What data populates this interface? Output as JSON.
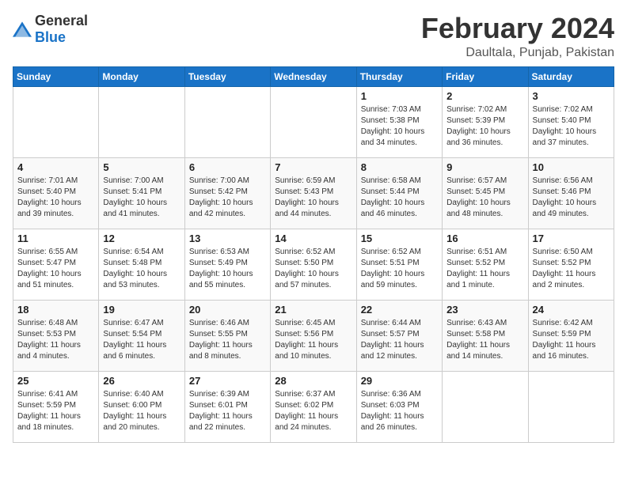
{
  "logo": {
    "general": "General",
    "blue": "Blue"
  },
  "title": "February 2024",
  "location": "Daultala, Punjab, Pakistan",
  "days_of_week": [
    "Sunday",
    "Monday",
    "Tuesday",
    "Wednesday",
    "Thursday",
    "Friday",
    "Saturday"
  ],
  "weeks": [
    [
      {
        "day": "",
        "info": ""
      },
      {
        "day": "",
        "info": ""
      },
      {
        "day": "",
        "info": ""
      },
      {
        "day": "",
        "info": ""
      },
      {
        "day": "1",
        "info": "Sunrise: 7:03 AM\nSunset: 5:38 PM\nDaylight: 10 hours\nand 34 minutes."
      },
      {
        "day": "2",
        "info": "Sunrise: 7:02 AM\nSunset: 5:39 PM\nDaylight: 10 hours\nand 36 minutes."
      },
      {
        "day": "3",
        "info": "Sunrise: 7:02 AM\nSunset: 5:40 PM\nDaylight: 10 hours\nand 37 minutes."
      }
    ],
    [
      {
        "day": "4",
        "info": "Sunrise: 7:01 AM\nSunset: 5:40 PM\nDaylight: 10 hours\nand 39 minutes."
      },
      {
        "day": "5",
        "info": "Sunrise: 7:00 AM\nSunset: 5:41 PM\nDaylight: 10 hours\nand 41 minutes."
      },
      {
        "day": "6",
        "info": "Sunrise: 7:00 AM\nSunset: 5:42 PM\nDaylight: 10 hours\nand 42 minutes."
      },
      {
        "day": "7",
        "info": "Sunrise: 6:59 AM\nSunset: 5:43 PM\nDaylight: 10 hours\nand 44 minutes."
      },
      {
        "day": "8",
        "info": "Sunrise: 6:58 AM\nSunset: 5:44 PM\nDaylight: 10 hours\nand 46 minutes."
      },
      {
        "day": "9",
        "info": "Sunrise: 6:57 AM\nSunset: 5:45 PM\nDaylight: 10 hours\nand 48 minutes."
      },
      {
        "day": "10",
        "info": "Sunrise: 6:56 AM\nSunset: 5:46 PM\nDaylight: 10 hours\nand 49 minutes."
      }
    ],
    [
      {
        "day": "11",
        "info": "Sunrise: 6:55 AM\nSunset: 5:47 PM\nDaylight: 10 hours\nand 51 minutes."
      },
      {
        "day": "12",
        "info": "Sunrise: 6:54 AM\nSunset: 5:48 PM\nDaylight: 10 hours\nand 53 minutes."
      },
      {
        "day": "13",
        "info": "Sunrise: 6:53 AM\nSunset: 5:49 PM\nDaylight: 10 hours\nand 55 minutes."
      },
      {
        "day": "14",
        "info": "Sunrise: 6:52 AM\nSunset: 5:50 PM\nDaylight: 10 hours\nand 57 minutes."
      },
      {
        "day": "15",
        "info": "Sunrise: 6:52 AM\nSunset: 5:51 PM\nDaylight: 10 hours\nand 59 minutes."
      },
      {
        "day": "16",
        "info": "Sunrise: 6:51 AM\nSunset: 5:52 PM\nDaylight: 11 hours\nand 1 minute."
      },
      {
        "day": "17",
        "info": "Sunrise: 6:50 AM\nSunset: 5:52 PM\nDaylight: 11 hours\nand 2 minutes."
      }
    ],
    [
      {
        "day": "18",
        "info": "Sunrise: 6:48 AM\nSunset: 5:53 PM\nDaylight: 11 hours\nand 4 minutes."
      },
      {
        "day": "19",
        "info": "Sunrise: 6:47 AM\nSunset: 5:54 PM\nDaylight: 11 hours\nand 6 minutes."
      },
      {
        "day": "20",
        "info": "Sunrise: 6:46 AM\nSunset: 5:55 PM\nDaylight: 11 hours\nand 8 minutes."
      },
      {
        "day": "21",
        "info": "Sunrise: 6:45 AM\nSunset: 5:56 PM\nDaylight: 11 hours\nand 10 minutes."
      },
      {
        "day": "22",
        "info": "Sunrise: 6:44 AM\nSunset: 5:57 PM\nDaylight: 11 hours\nand 12 minutes."
      },
      {
        "day": "23",
        "info": "Sunrise: 6:43 AM\nSunset: 5:58 PM\nDaylight: 11 hours\nand 14 minutes."
      },
      {
        "day": "24",
        "info": "Sunrise: 6:42 AM\nSunset: 5:59 PM\nDaylight: 11 hours\nand 16 minutes."
      }
    ],
    [
      {
        "day": "25",
        "info": "Sunrise: 6:41 AM\nSunset: 5:59 PM\nDaylight: 11 hours\nand 18 minutes."
      },
      {
        "day": "26",
        "info": "Sunrise: 6:40 AM\nSunset: 6:00 PM\nDaylight: 11 hours\nand 20 minutes."
      },
      {
        "day": "27",
        "info": "Sunrise: 6:39 AM\nSunset: 6:01 PM\nDaylight: 11 hours\nand 22 minutes."
      },
      {
        "day": "28",
        "info": "Sunrise: 6:37 AM\nSunset: 6:02 PM\nDaylight: 11 hours\nand 24 minutes."
      },
      {
        "day": "29",
        "info": "Sunrise: 6:36 AM\nSunset: 6:03 PM\nDaylight: 11 hours\nand 26 minutes."
      },
      {
        "day": "",
        "info": ""
      },
      {
        "day": "",
        "info": ""
      }
    ]
  ]
}
